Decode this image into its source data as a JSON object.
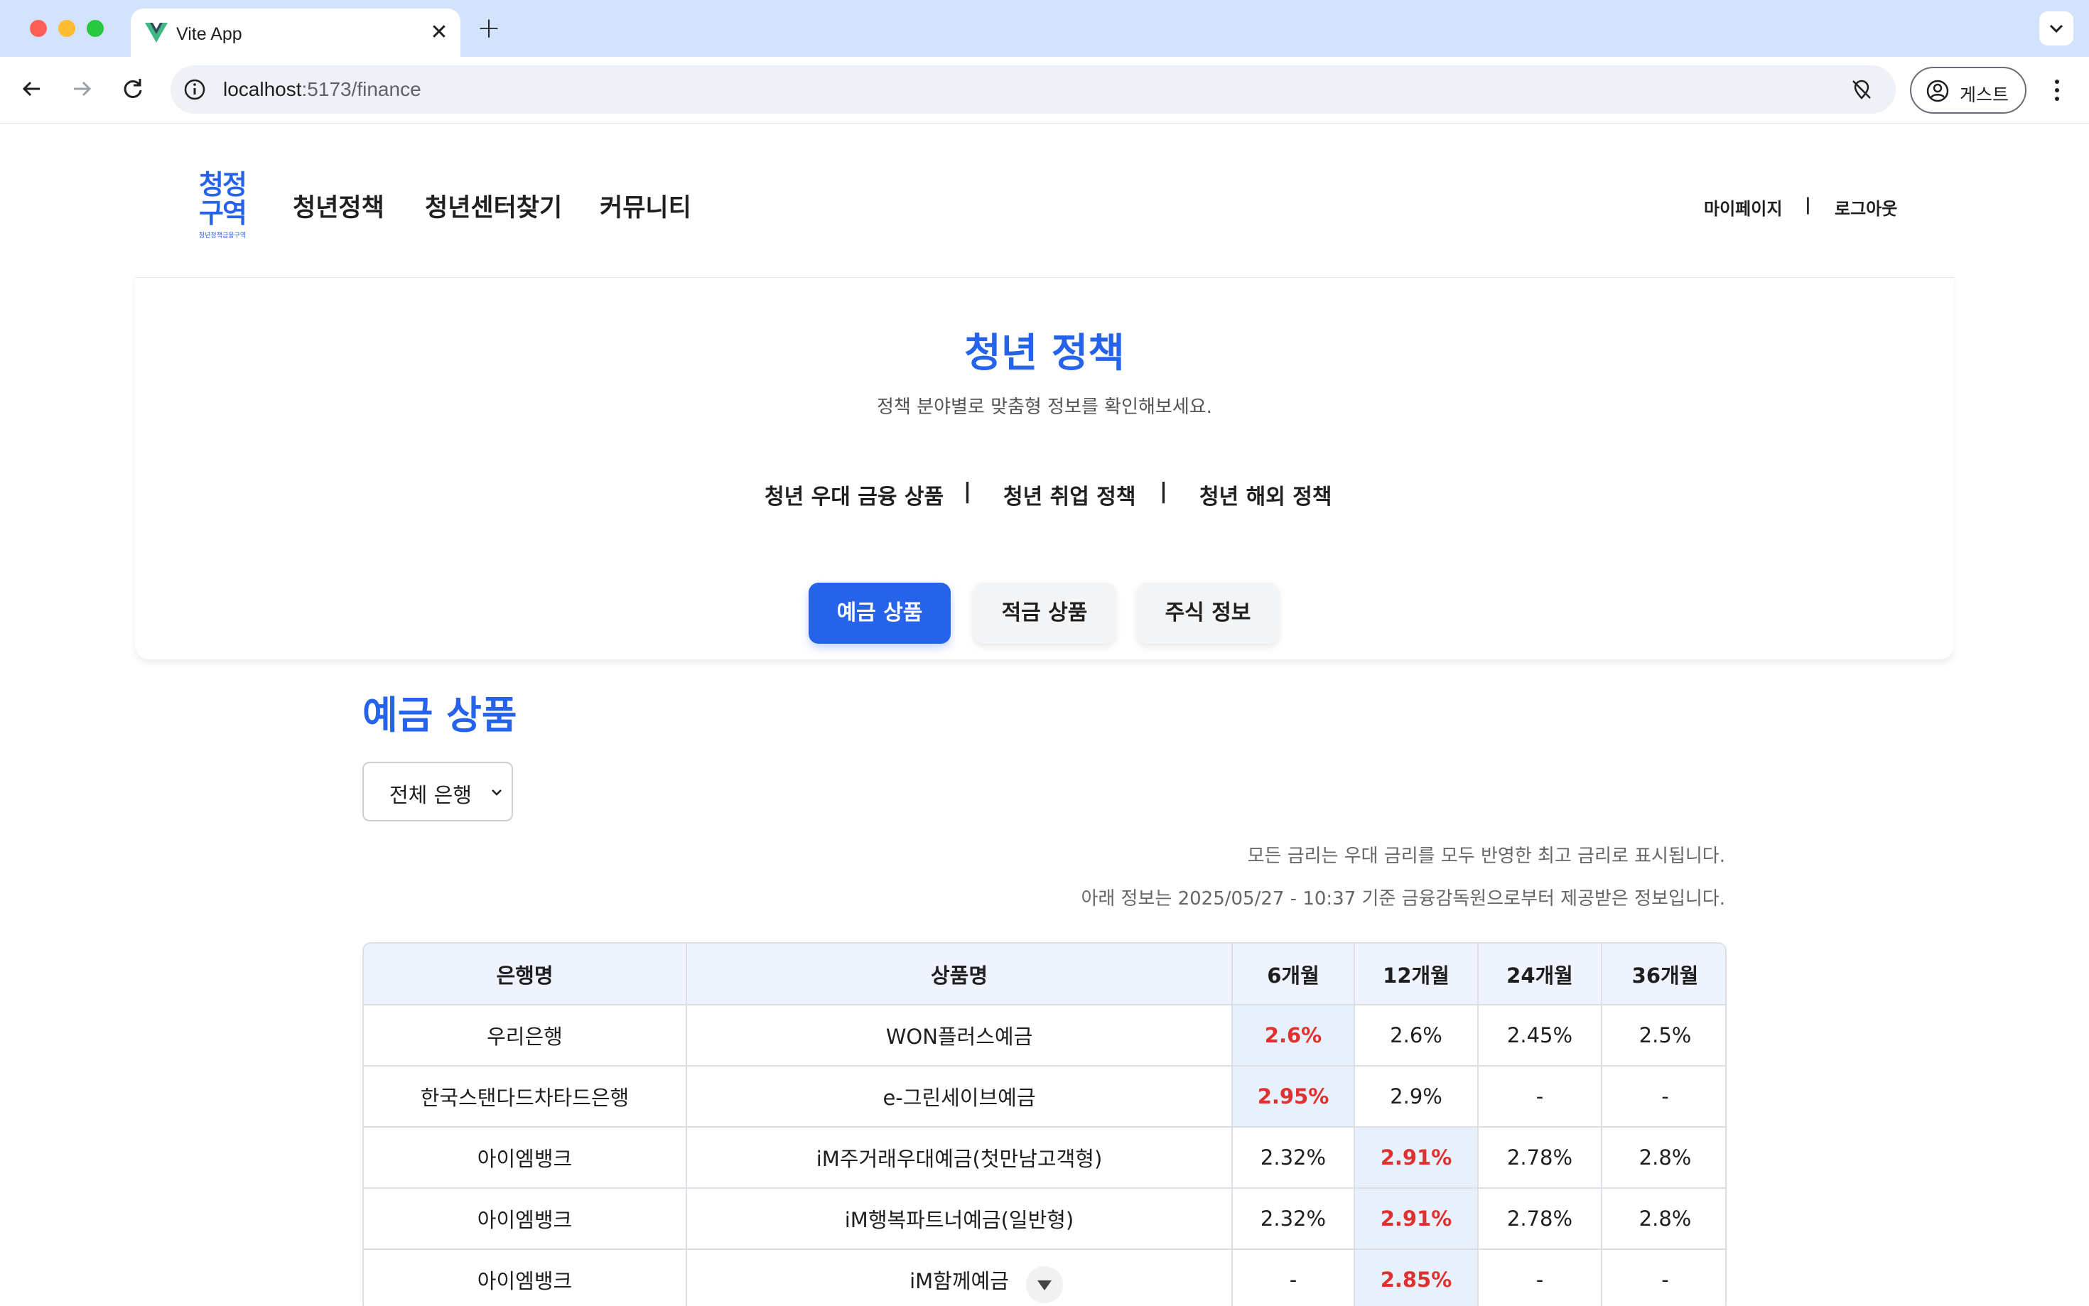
{
  "browser": {
    "tab_title": "Vite App",
    "tab_close": "✕",
    "new_tab": "+",
    "url_host": "localhost",
    "url_rest": ":5173/finance",
    "profile_label": "게스트"
  },
  "site": {
    "logo_line1": "청정",
    "logo_line2": "구역",
    "logo_sub": "청년정책금융구역",
    "nav": [
      "청년정책",
      "청년센터찾기",
      "커뮤니티"
    ],
    "user_nav": {
      "mypage": "마이페이지",
      "sep": "|",
      "logout": "로그아웃"
    }
  },
  "header": {
    "title": "청년 정책",
    "subtitle": "정책 분야별로 맞춤형 정보를 확인해보세요.",
    "policy_links": [
      "청년 우대 금융 상품",
      "청년 취업 정책",
      "청년 해외 정책"
    ],
    "sep": "|"
  },
  "product_tabs": {
    "items": [
      "예금 상품",
      "적금 상품",
      "주식 정보"
    ],
    "active": "예금 상품"
  },
  "section": {
    "title": "예금 상품",
    "bank_filter": "전체 은행",
    "note1": "모든 금리는 우대 금리를 모두 반영한 최고 금리로 표시됩니다.",
    "note2": "아래 정보는 2025/05/27 - 10:37 기준 금융감독원으로부터 제공받은 정보입니다."
  },
  "table": {
    "headers": [
      "은행명",
      "상품명",
      "6개월",
      "12개월",
      "24개월",
      "36개월"
    ],
    "rows": [
      [
        "우리은행",
        "WON플러스예금",
        "2.6%",
        "2.6%",
        "2.45%",
        "2.5%"
      ],
      [
        "한국스탠다드차타드은행",
        "e-그린세이브예금",
        "2.95%",
        "2.9%",
        "-",
        "-"
      ],
      [
        "아이엠뱅크",
        "iM주거래우대예금(첫만남고객형)",
        "2.32%",
        "2.91%",
        "2.78%",
        "2.8%"
      ],
      [
        "아이엠뱅크",
        "iM행복파트너예금(일반형)",
        "2.32%",
        "2.91%",
        "2.78%",
        "2.8%"
      ],
      [
        "아이엠뱅크",
        "iM함께예금",
        "-",
        "2.85%",
        "-",
        "-"
      ]
    ],
    "highlight_col": [
      2,
      2,
      3,
      3,
      3
    ]
  },
  "colors": {
    "brand": "#2563eb",
    "highlight_text": "#e03131",
    "highlight_bg": "#e8f0fc"
  }
}
